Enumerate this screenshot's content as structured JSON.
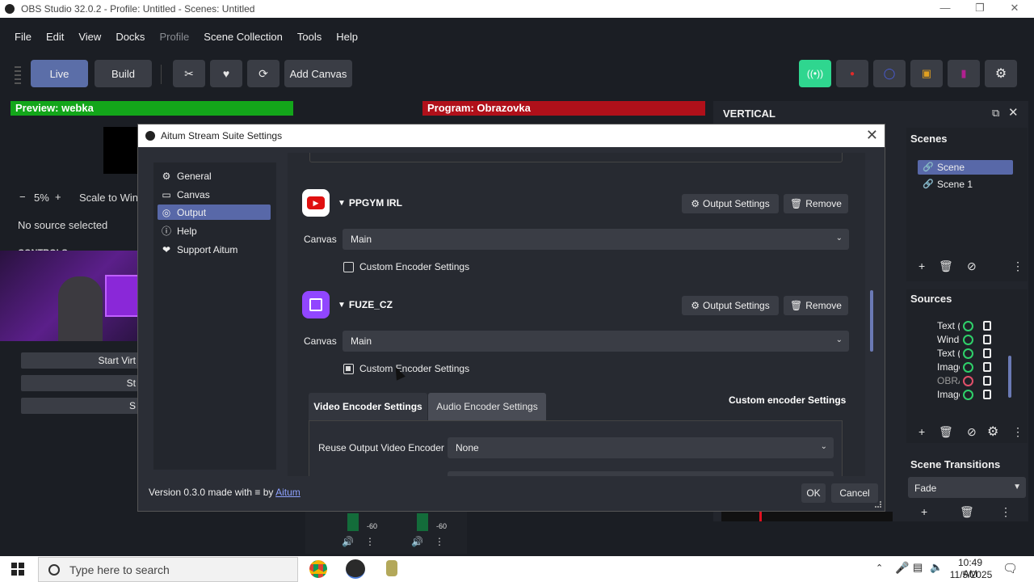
{
  "window": {
    "title": "OBS Studio 32.0.2 - Profile: Untitled - Scenes: Untitled"
  },
  "menu": [
    "File",
    "Edit",
    "View",
    "Docks",
    "Profile",
    "Scene Collection",
    "Tools",
    "Help"
  ],
  "toolbar": {
    "live": "Live",
    "build": "Build",
    "add_canvas": "Add Canvas"
  },
  "preview": {
    "label": "Preview: webka",
    "zoom": "5%",
    "scale": "Scale to Wind",
    "no_source": "No source selected",
    "controls": "CONTROLS"
  },
  "program": {
    "label": "Program: Obrazovka"
  },
  "left_controls": [
    "Start Virt",
    "St",
    "S"
  ],
  "vertical": {
    "title": "VERTICAL"
  },
  "scenes": {
    "header": "Scenes",
    "items": [
      "Scene",
      "Scene 1"
    ]
  },
  "sources": {
    "header": "Sources",
    "items": [
      "Text (",
      "Windo",
      "Text (",
      "Image",
      "OBRA",
      "Image"
    ]
  },
  "transitions": {
    "header": "Scene Transitions",
    "selected": "Fade"
  },
  "mixer": {
    "level_a": "-60",
    "level_b": "-60"
  },
  "dialog": {
    "title": "Aitum Stream Suite Settings",
    "nav": [
      "General",
      "Canvas",
      "Output",
      "Help",
      "Support Aitum"
    ],
    "outputs": [
      {
        "name": "PPGYM IRL",
        "canvas_label": "Canvas",
        "canvas": "Main",
        "custom": "Custom Encoder Settings",
        "output_settings": "Output Settings",
        "remove": "Remove"
      },
      {
        "name": "FUZE_CZ",
        "canvas_label": "Canvas",
        "canvas": "Main",
        "custom": "Custom Encoder Settings",
        "output_settings": "Output Settings",
        "remove": "Remove"
      }
    ],
    "tabs": {
      "video": "Video Encoder Settings",
      "audio": "Audio Encoder Settings",
      "right_label": "Custom encoder Settings"
    },
    "reuse_label": "Reuse Output Video Encoder",
    "reuse_value": "None",
    "version_prefix": "Version 0.3.0 made with ≡ by",
    "version_link": "Aitum",
    "ok": "OK",
    "cancel": "Cancel"
  },
  "taskbar": {
    "search_placeholder": "Type here to search",
    "time": "10:49 AM",
    "date": "11/5/2025"
  }
}
